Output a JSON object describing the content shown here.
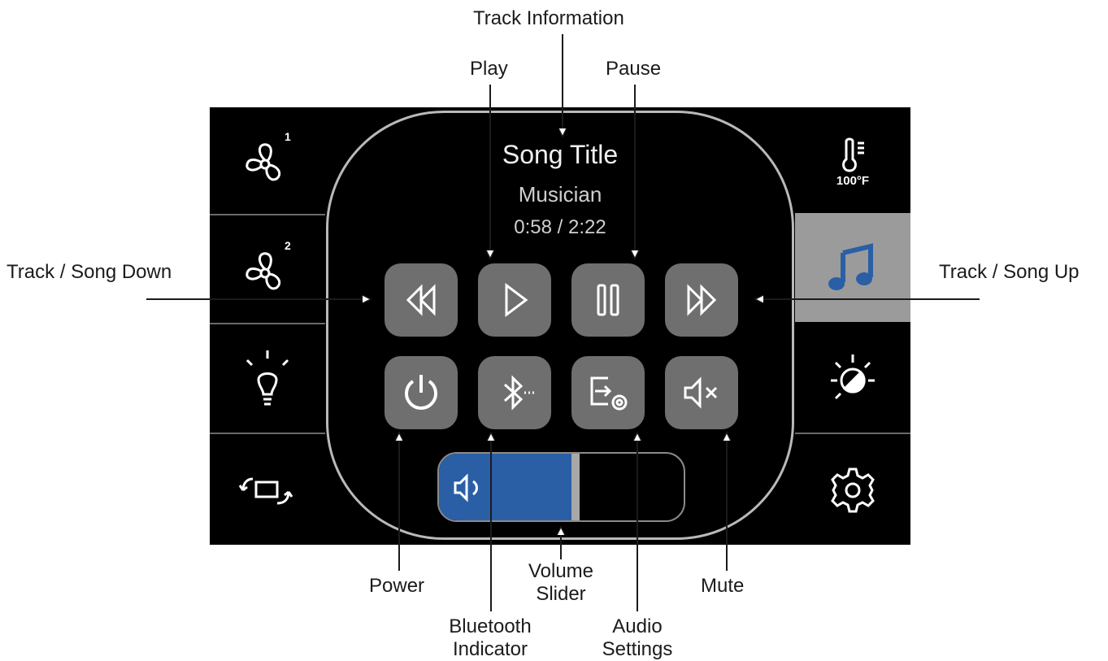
{
  "callouts": {
    "track_information": "Track Information",
    "play": "Play",
    "pause": "Pause",
    "track_down": "Track / Song Down",
    "track_up": "Track / Song Up",
    "power": "Power",
    "bluetooth_line1": "Bluetooth",
    "bluetooth_line2": "Indicator",
    "volume_line1": "Volume",
    "volume_line2": "Slider",
    "audio_line1": "Audio",
    "audio_line2": "Settings",
    "mute": "Mute"
  },
  "track": {
    "title": "Song Title",
    "artist": "Musician",
    "time": "0:58 / 2:22"
  },
  "sidebar_left": [
    {
      "icon": "fan-1-icon",
      "badge": "1"
    },
    {
      "icon": "fan-2-icon",
      "badge": "2"
    },
    {
      "icon": "light-bulb-icon"
    },
    {
      "icon": "rotate-screen-icon"
    }
  ],
  "sidebar_right": [
    {
      "icon": "thermometer-icon",
      "label": "100°F"
    },
    {
      "icon": "music-note-icon",
      "active": true
    },
    {
      "icon": "brightness-icon"
    },
    {
      "icon": "gear-icon"
    }
  ],
  "controls_row1": [
    "rewind-icon",
    "play-icon",
    "pause-icon",
    "fast-forward-icon"
  ],
  "controls_row2": [
    "power-icon",
    "bluetooth-icon",
    "audio-settings-icon",
    "mute-icon"
  ],
  "volume": {
    "level": 0.54
  },
  "colors": {
    "accent_blue": "#2a5fa5",
    "active_tab": "#9b9b9b",
    "button_gray": "#6f6f6f"
  }
}
